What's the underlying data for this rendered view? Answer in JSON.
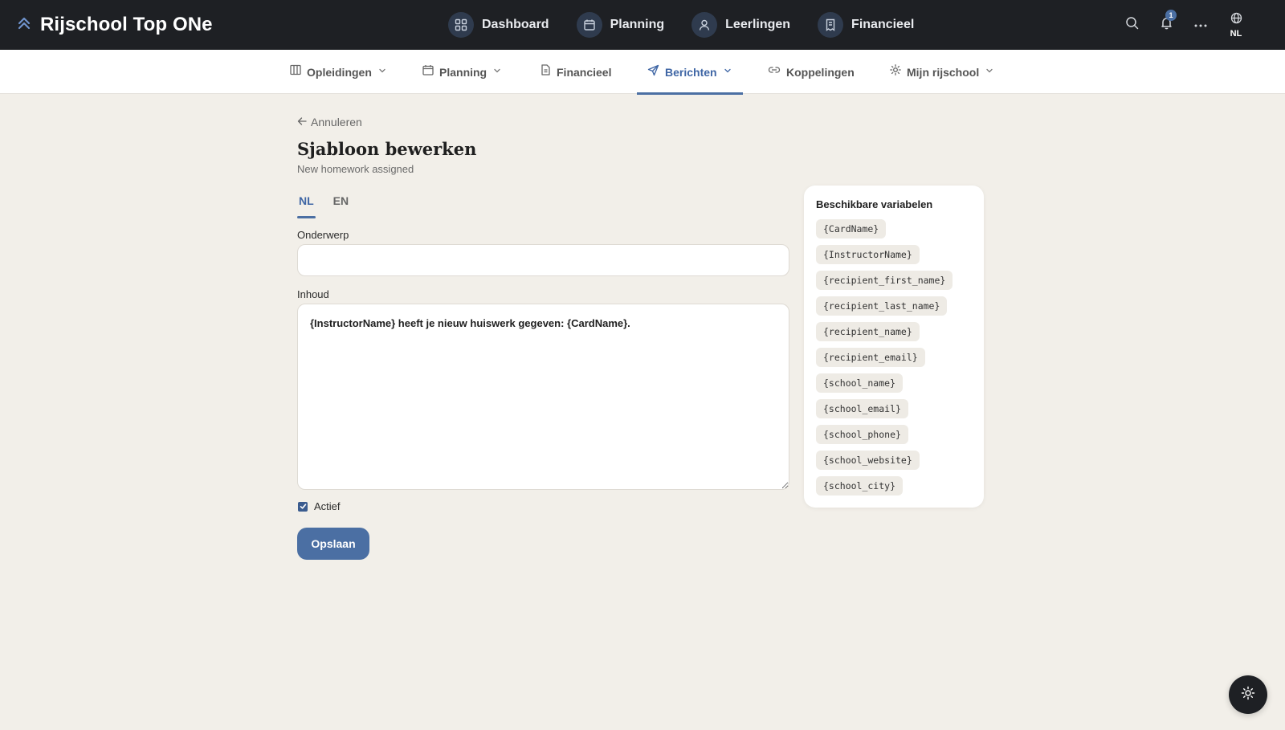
{
  "app": {
    "title": "Rijschool Top ONe"
  },
  "mainnav": {
    "items": [
      {
        "label": "Dashboard",
        "icon": "dashboard-grid-icon"
      },
      {
        "label": "Planning",
        "icon": "calendar-icon"
      },
      {
        "label": "Leerlingen",
        "icon": "user-icon"
      },
      {
        "label": "Financieel",
        "icon": "receipt-icon"
      }
    ]
  },
  "topright": {
    "notification_count": "1",
    "language": "NL"
  },
  "subnav": {
    "items": [
      {
        "label": "Opleidingen",
        "icon": "columns-icon",
        "dropdown": true
      },
      {
        "label": "Planning",
        "icon": "calendar-icon",
        "dropdown": true
      },
      {
        "label": "Financieel",
        "icon": "document-icon",
        "dropdown": false
      },
      {
        "label": "Berichten",
        "icon": "send-icon",
        "dropdown": true,
        "active": true
      },
      {
        "label": "Koppelingen",
        "icon": "link-icon",
        "dropdown": false
      },
      {
        "label": "Mijn rijschool",
        "icon": "settings-sun-icon",
        "dropdown": true
      }
    ]
  },
  "page": {
    "back_label": "Annuleren",
    "title": "Sjabloon bewerken",
    "subtitle": "New homework assigned"
  },
  "tabs": [
    {
      "label": "NL",
      "active": true
    },
    {
      "label": "EN",
      "active": false
    }
  ],
  "form": {
    "subject_label": "Onderwerp",
    "subject_value": "",
    "content_label": "Inhoud",
    "content_value": "{InstructorName} heeft je nieuw huiswerk gegeven: {CardName}.",
    "active_label": "Actief",
    "active_checked": true,
    "save_label": "Opslaan"
  },
  "variables": {
    "title": "Beschikbare variabelen",
    "items": [
      "{CardName}",
      "{InstructorName}",
      "{recipient_first_name}",
      "{recipient_last_name}",
      "{recipient_name}",
      "{recipient_email}",
      "{school_name}",
      "{school_email}",
      "{school_phone}",
      "{school_website}",
      "{school_city}"
    ]
  },
  "colors": {
    "topbar": "#1e2024",
    "accent": "#4b6fa3",
    "background": "#f2efe9"
  }
}
